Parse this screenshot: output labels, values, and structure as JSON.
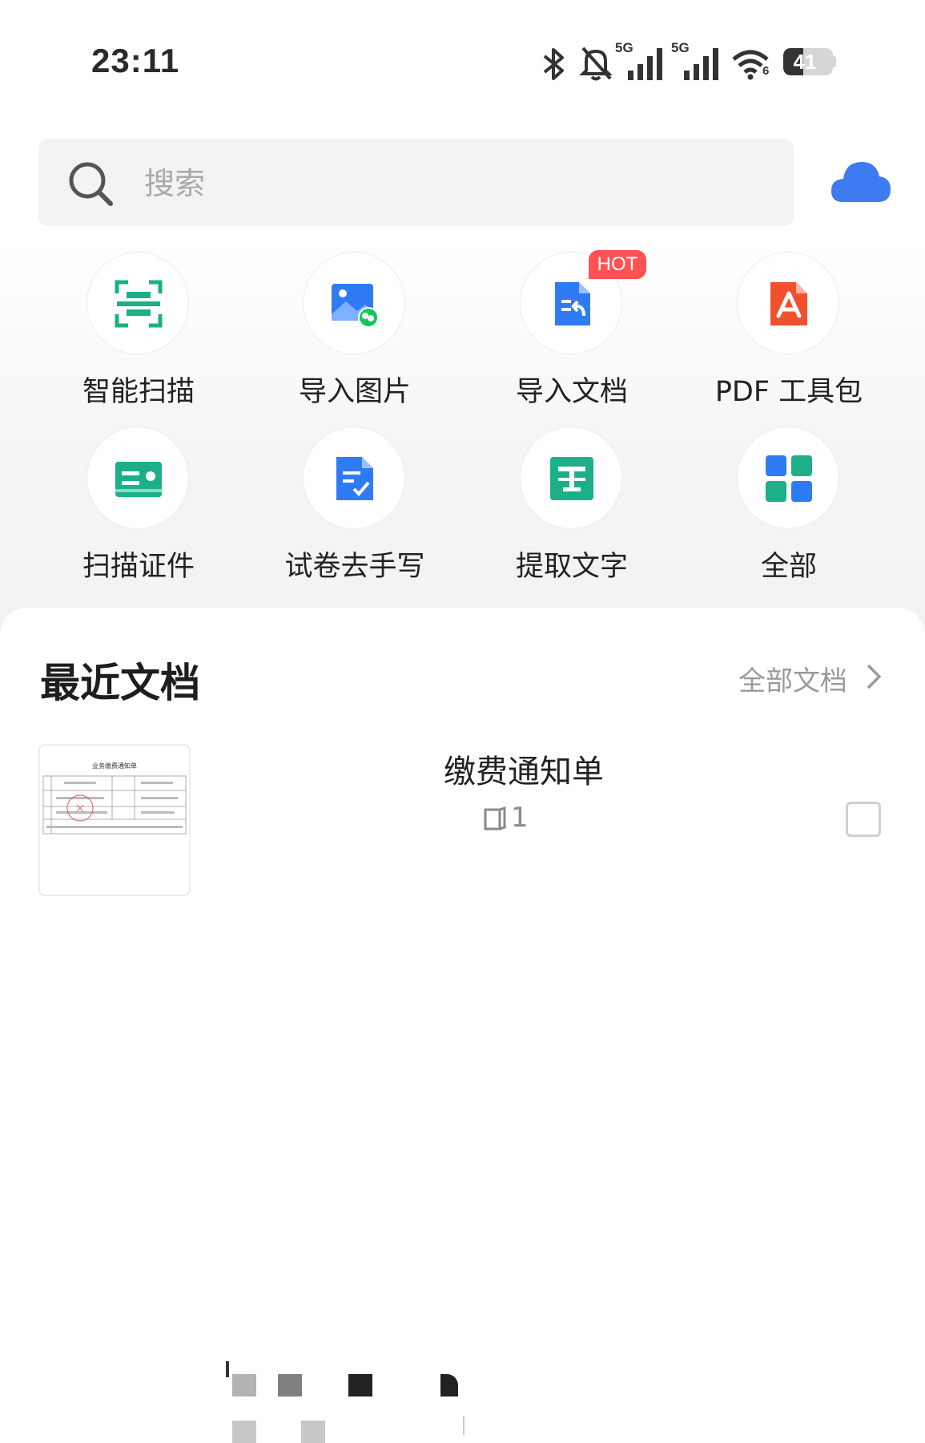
{
  "status_bar": {
    "time": "23:11",
    "net1": "5G",
    "net2": "5G",
    "wifi_sub": "6",
    "battery": "41",
    "icons": [
      "bluetooth-icon",
      "bell-muted-icon",
      "signal-icon",
      "signal-icon",
      "wifi-icon",
      "battery-icon"
    ]
  },
  "search": {
    "placeholder": "搜索",
    "icon": "search-icon"
  },
  "cloud": {
    "icon": "cloud-icon",
    "color": "#3d7bf0"
  },
  "tools": [
    {
      "label": "智能扫描",
      "icon": "scan-icon",
      "color": "#1bb087"
    },
    {
      "label": "导入图片",
      "icon": "image-wechat-icon",
      "color": "#2f7bf5"
    },
    {
      "label": "导入文档",
      "icon": "import-doc-icon",
      "color": "#2f7bf5",
      "badge": "HOT"
    },
    {
      "label": "PDF 工具包",
      "icon": "pdf-icon",
      "color": "#f0502e"
    },
    {
      "label": "扫描证件",
      "icon": "id-card-icon",
      "color": "#1bb087"
    },
    {
      "label": "试卷去手写",
      "icon": "exam-icon",
      "color": "#2f7bf5"
    },
    {
      "label": "提取文字",
      "icon": "extract-text-icon",
      "color": "#1bb087"
    },
    {
      "label": "全部",
      "icon": "grid-icon",
      "color": "#2f7bf5"
    }
  ],
  "recent": {
    "title": "最近文档",
    "all_label": "全部文档",
    "documents": [
      {
        "title": "缴费通知单",
        "thumb_title": "业务缴费通知单",
        "pages": "1"
      }
    ]
  },
  "colors": {
    "hot": "#ff5252",
    "accent_blue": "#2f7bf5",
    "accent_green": "#1bb087"
  }
}
